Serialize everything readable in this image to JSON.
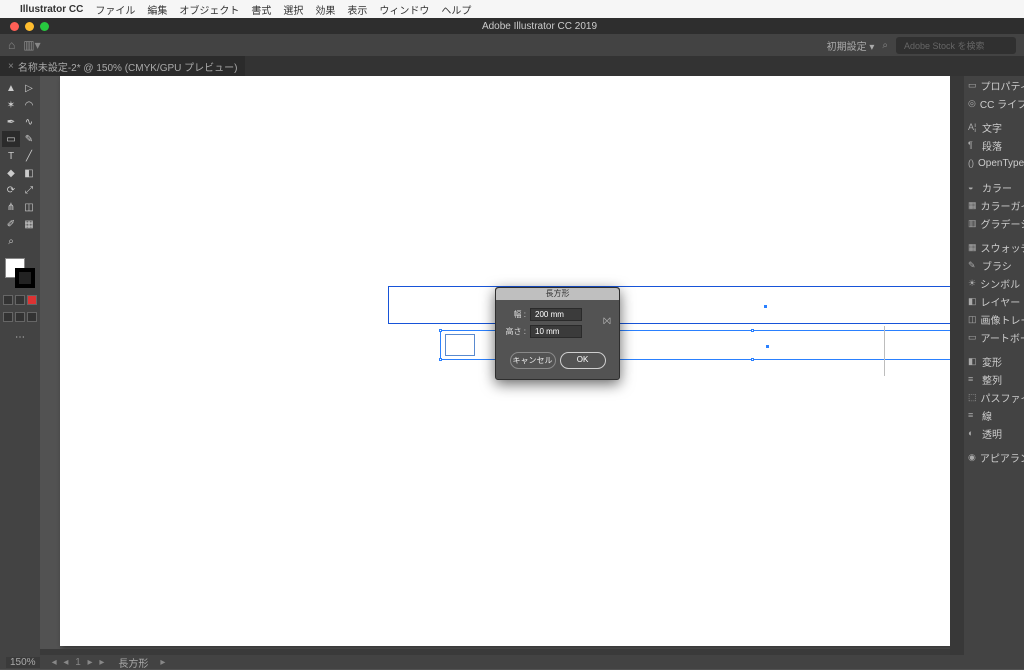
{
  "macmenu": {
    "app": "Illustrator CC",
    "items": [
      "ファイル",
      "編集",
      "オブジェクト",
      "書式",
      "選択",
      "効果",
      "表示",
      "ウィンドウ",
      "ヘルプ"
    ]
  },
  "title": "Adobe Illustrator CC 2019",
  "workspace": "初期設定",
  "search_placeholder": "Adobe Stock を検索",
  "tab": {
    "label": "名称未設定-2* @ 150% (CMYK/GPU プレビュー)"
  },
  "dialog": {
    "title": "長方形",
    "width_label": "幅 :",
    "width_value": "200 mm",
    "height_label": "高さ :",
    "height_value": "10 mm",
    "cancel": "キャンセル",
    "ok": "OK"
  },
  "panels": [
    "プロパティ",
    "CC ライブラ..",
    "",
    "文字",
    "段落",
    "OpenType",
    "",
    "カラー",
    "カラーガイド",
    "グラデーショ..",
    "",
    "スウォッチ",
    "ブラシ",
    "シンボル",
    "レイヤー",
    "画像トレース",
    "アートボード",
    "",
    "変形",
    "整列",
    "パスファイ..",
    "線",
    "透明",
    "",
    "アピアランス"
  ],
  "panel_icons": [
    "▭",
    "◎",
    " ",
    "A¦",
    "¶",
    "()",
    " ",
    "◒",
    "▦",
    "▥",
    " ",
    "▦",
    "✎",
    "☀",
    "◧",
    "◫",
    "▭",
    " ",
    "◧",
    "≡",
    "⬚",
    "≡",
    "◐",
    " ",
    "◉"
  ],
  "status": {
    "zoom": "150%",
    "page": "1",
    "tool": "長方形"
  }
}
